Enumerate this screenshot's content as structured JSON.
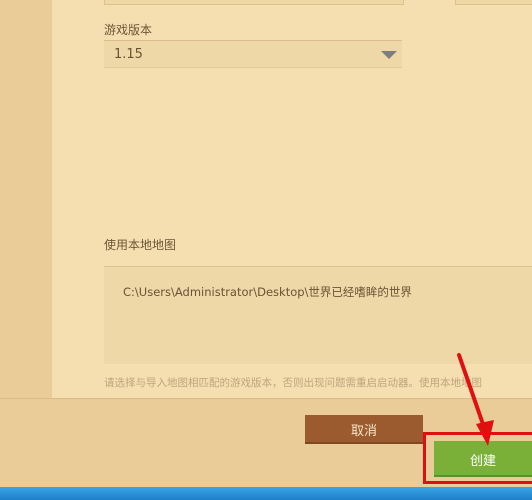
{
  "form": {
    "version_label": "游戏版本",
    "version_value": "1.15",
    "local_map_label": "使用本地地图",
    "local_map_path": "C:\\Users\\Administrator\\Desktop\\世界已经嗜眸的世界",
    "hint": "请选择与导入地图相匹配的游戏版本，否则出现问题需重启启动器。使用本地地图"
  },
  "footer": {
    "cancel_label": "取消",
    "create_label": "创建"
  },
  "annotation": {
    "highlight_color": "#e01010"
  },
  "colors": {
    "panel": "#f5deb0",
    "cancel": "#9b5b2e",
    "create": "#7ab038"
  }
}
